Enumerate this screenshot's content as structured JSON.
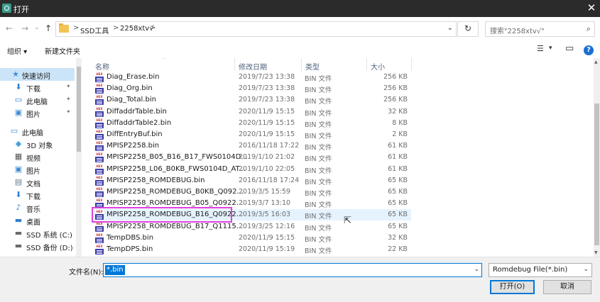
{
  "window": {
    "title": "打开",
    "close_glyph": "✕"
  },
  "nav": {
    "back": "←",
    "forward": "→",
    "recent": "⌄",
    "up": "↑"
  },
  "address": {
    "crumbs": [
      "SSD工具",
      "2258xtv√"
    ],
    "separators": [
      ">",
      ">",
      ">"
    ],
    "dropdown": "⌄",
    "refresh": "↻",
    "search_placeholder": "搜索\"2258xtv√\"",
    "search_icon": "⌕"
  },
  "toolbar": {
    "organize": "组织 ▾",
    "new_folder": "新建文件夹",
    "view_icon": "☰",
    "view_dropdown": "▾",
    "pane_icon": "▭",
    "help": "?"
  },
  "sidebar": {
    "items": [
      {
        "label": "快速访问",
        "icon": "star-icon",
        "glyph": "★",
        "color": "#3f8fd9",
        "pinned": false,
        "selected": true
      },
      {
        "label": "下载",
        "icon": "download-icon",
        "glyph": "⬇",
        "color": "#2f7fd0",
        "pinned": true
      },
      {
        "label": "此电脑",
        "icon": "desktop-icon",
        "glyph": "▭",
        "color": "#2f7fd0",
        "pinned": true
      },
      {
        "label": "图片",
        "icon": "pictures-icon",
        "glyph": "▣",
        "color": "#3d8bd4",
        "pinned": true
      },
      {
        "label": "此电脑",
        "icon": "computer-icon",
        "glyph": "▭",
        "color": "#3d8bd4",
        "pinned": false
      },
      {
        "label": "3D 对象",
        "icon": "cube-icon",
        "glyph": "◆",
        "color": "#4aa4e0",
        "pinned": false
      },
      {
        "label": "视频",
        "icon": "video-icon",
        "glyph": "▦",
        "color": "#555555",
        "pinned": false
      },
      {
        "label": "图片",
        "icon": "pictures-icon",
        "glyph": "▣",
        "color": "#3d8bd4",
        "pinned": false
      },
      {
        "label": "文档",
        "icon": "document-icon",
        "glyph": "▤",
        "color": "#6d7d8d",
        "pinned": false
      },
      {
        "label": "下载",
        "icon": "download-icon",
        "glyph": "⬇",
        "color": "#2f7fd0",
        "pinned": false
      },
      {
        "label": "音乐",
        "icon": "music-icon",
        "glyph": "♪",
        "color": "#2f7fd0",
        "pinned": false
      },
      {
        "label": "桌面",
        "icon": "desktop-icon",
        "glyph": "▬",
        "color": "#2f7fd0",
        "pinned": false
      },
      {
        "label": "SSD 系统 (C:)",
        "icon": "drive-icon",
        "glyph": "▬",
        "color": "#6b6b6b",
        "pinned": false
      },
      {
        "label": "SSD 备份 (D:)",
        "icon": "drive-icon",
        "glyph": "▬",
        "color": "#6b6b6b",
        "pinned": false
      }
    ],
    "pin_glyph": "📌"
  },
  "columns": {
    "sort_arrow": "^",
    "name": "名称",
    "date": "修改日期",
    "type": "类型",
    "size": "大小"
  },
  "files": [
    {
      "name": "Diag_Erase.bin",
      "date": "2019/7/23 13:38",
      "type": "BIN 文件",
      "size": "256 KB"
    },
    {
      "name": "Diag_Org.bin",
      "date": "2019/7/23 13:38",
      "type": "BIN 文件",
      "size": "256 KB"
    },
    {
      "name": "Diag_Total.bin",
      "date": "2019/7/23 13:38",
      "type": "BIN 文件",
      "size": "256 KB"
    },
    {
      "name": "DiffaddrTable.bin",
      "date": "2020/11/9 15:15",
      "type": "BIN 文件",
      "size": "32 KB"
    },
    {
      "name": "DiffaddrTable2.bin",
      "date": "2020/11/9 15:15",
      "type": "BIN 文件",
      "size": "8 KB"
    },
    {
      "name": "DiffEntryBuf.bin",
      "date": "2020/11/9 15:15",
      "type": "BIN 文件",
      "size": "2 KB"
    },
    {
      "name": "MPISP2258.bin",
      "date": "2016/11/18 17:22",
      "type": "BIN 文件",
      "size": "61 KB"
    },
    {
      "name": "MPISP2258_B05_B16_B17_FWS0104D...",
      "date": "2019/1/10 21:02",
      "type": "BIN 文件",
      "size": "61 KB"
    },
    {
      "name": "MPISP2258_L06_B0KB_FWS0104D_AT...",
      "date": "2019/1/10 22:05",
      "type": "BIN 文件",
      "size": "61 KB"
    },
    {
      "name": "MPISP2258_ROMDEBUG.bin",
      "date": "2016/11/18 17:24",
      "type": "BIN 文件",
      "size": "65 KB"
    },
    {
      "name": "MPISP2258_ROMDEBUG_B0KB_Q092...",
      "date": "2019/3/5 15:59",
      "type": "BIN 文件",
      "size": "65 KB"
    },
    {
      "name": "MPISP2258_ROMDEBUG_B05_Q0922...",
      "date": "2019/3/7 13:10",
      "type": "BIN 文件",
      "size": "65 KB"
    },
    {
      "name": "MPISP2258_ROMDEBUG_B16_Q0922...",
      "date": "2019/3/5 16:03",
      "type": "BIN 文件",
      "size": "65 KB",
      "hover": true
    },
    {
      "name": "MPISP2258_ROMDEBUG_B17_Q1115...",
      "date": "2019/3/25 12:16",
      "type": "BIN 文件",
      "size": "65 KB"
    },
    {
      "name": "TempDBS.bin",
      "date": "2020/11/9 15:15",
      "type": "BIN 文件",
      "size": "32 KB"
    },
    {
      "name": "TempDPS.bin",
      "date": "2020/11/9 15:19",
      "type": "BIN 文件",
      "size": "22 KB"
    }
  ],
  "bottom": {
    "filename_label": "文件名(N):",
    "filename_value": "*.bin",
    "filter_value": "Romdebug File(*.bin)",
    "open_button": "打开(O)",
    "cancel_button": "取消",
    "dropdown": "⌄"
  },
  "colors": {
    "accent": "#0078d7",
    "highlight_box": "#e040e0",
    "titlebar": "#2b2b2b"
  }
}
